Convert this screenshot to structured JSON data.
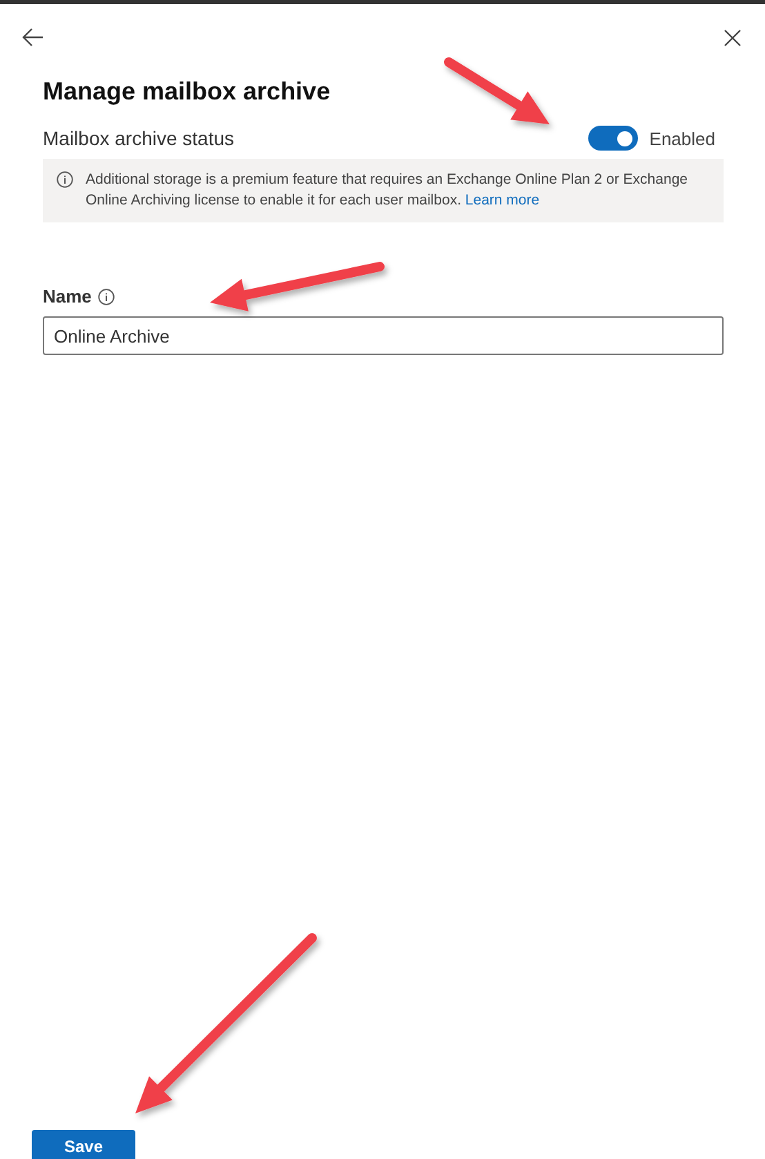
{
  "panel": {
    "title": "Manage mailbox archive"
  },
  "archive_status": {
    "label": "Mailbox archive status",
    "on": true,
    "state_label": "Enabled"
  },
  "info": {
    "text": "Additional storage is a premium feature that requires an Exchange Online Plan 2 or Exchange Online Archiving license to enable it for each user mailbox.",
    "link": "Learn more"
  },
  "name_field": {
    "label": "Name",
    "value": "Online Archive"
  },
  "buttons": [
    "Save"
  ]
}
